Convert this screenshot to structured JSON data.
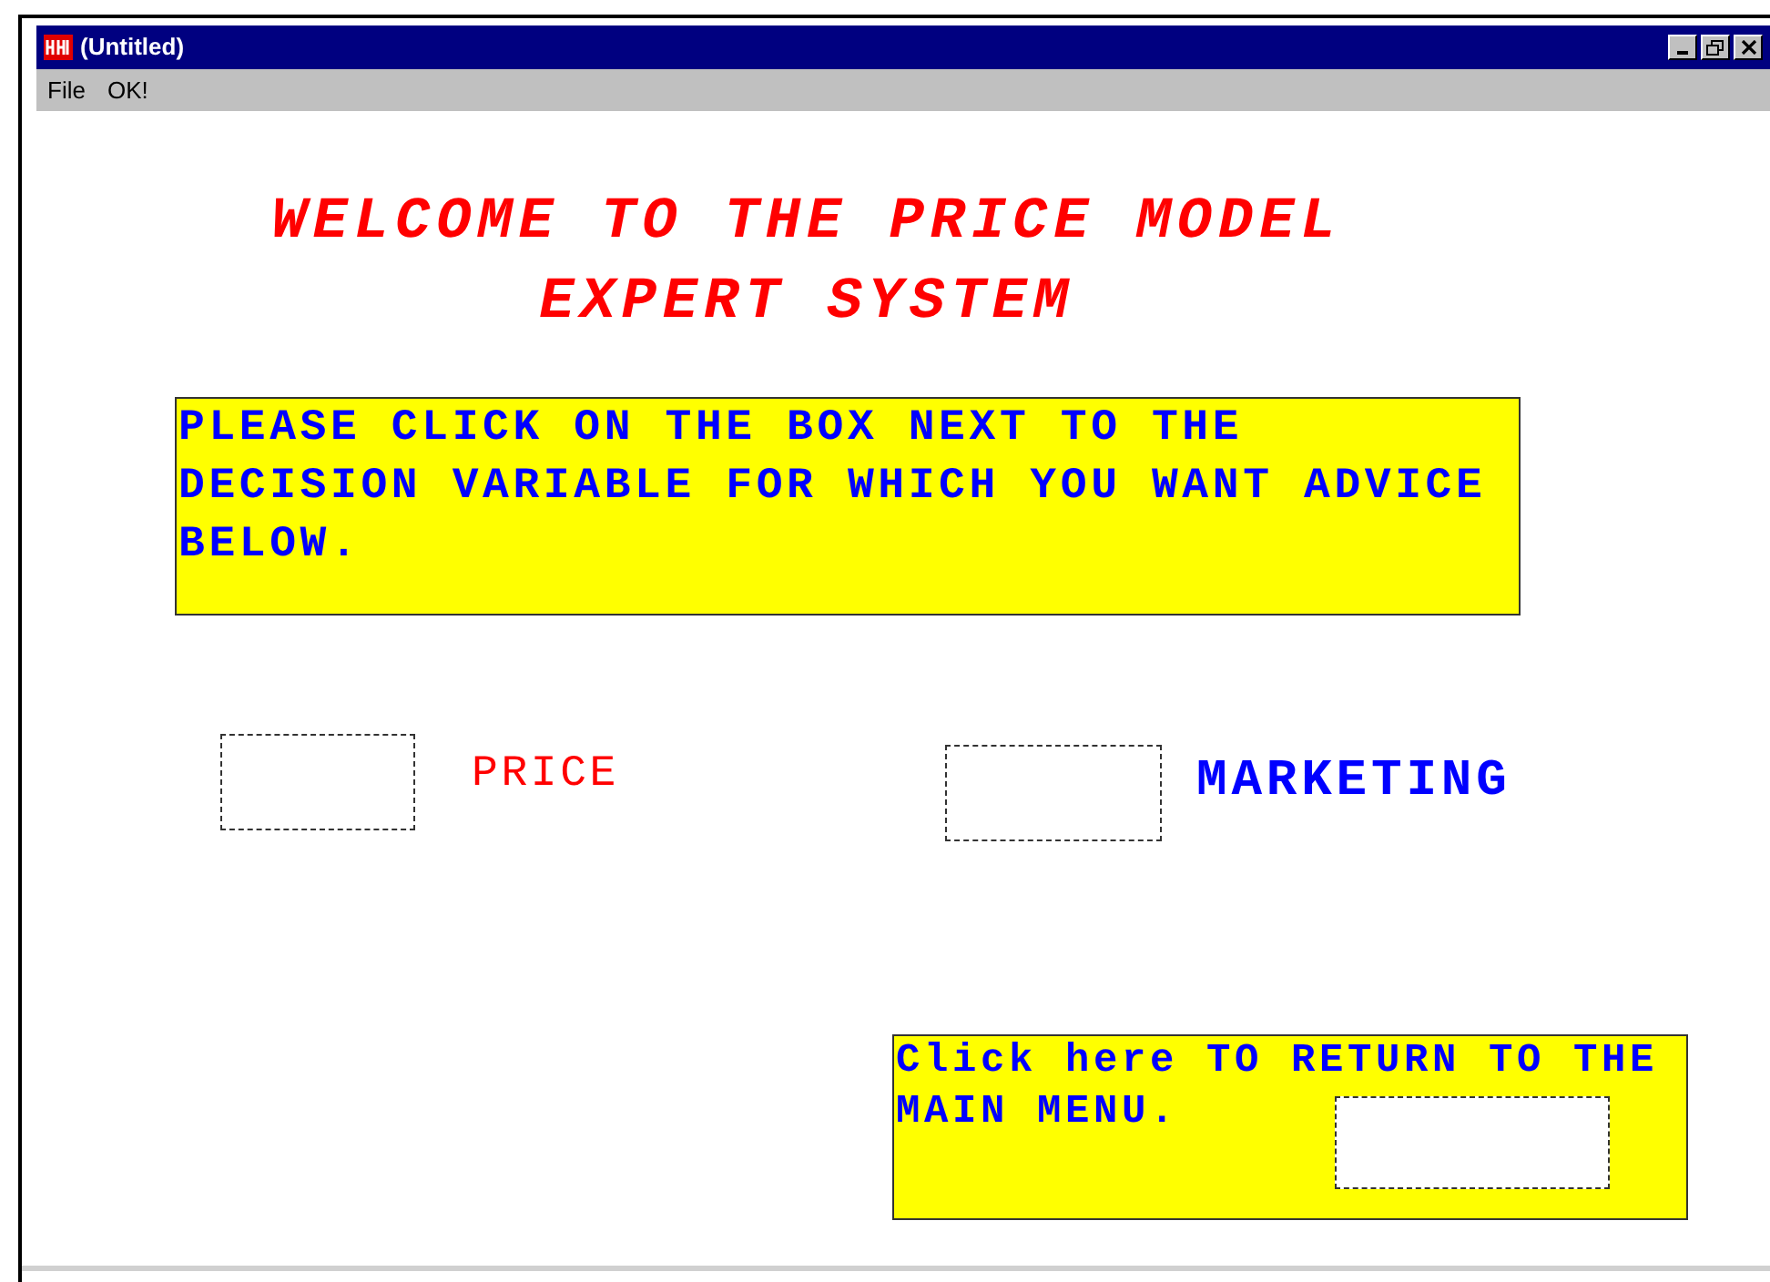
{
  "window": {
    "title": "(Untitled)"
  },
  "menu": [
    "File",
    "OK!"
  ],
  "heading": [
    "WELCOME TO THE PRICE MODEL",
    "EXPERT SYSTEM"
  ],
  "instruction": "PLEASE CLICK ON THE BOX NEXT TO THE DECISION VARIABLE FOR WHICH YOU WANT ADVICE BELOW.",
  "options": [
    {
      "label": "PRICE",
      "color": "#ff0000",
      "checked": false
    },
    {
      "label": "MARKETING",
      "color": "#0000ff",
      "checked": false
    }
  ],
  "return_panel": {
    "text": "Click here TO RETURN TO THE MAIN MENU.",
    "checked": false
  }
}
